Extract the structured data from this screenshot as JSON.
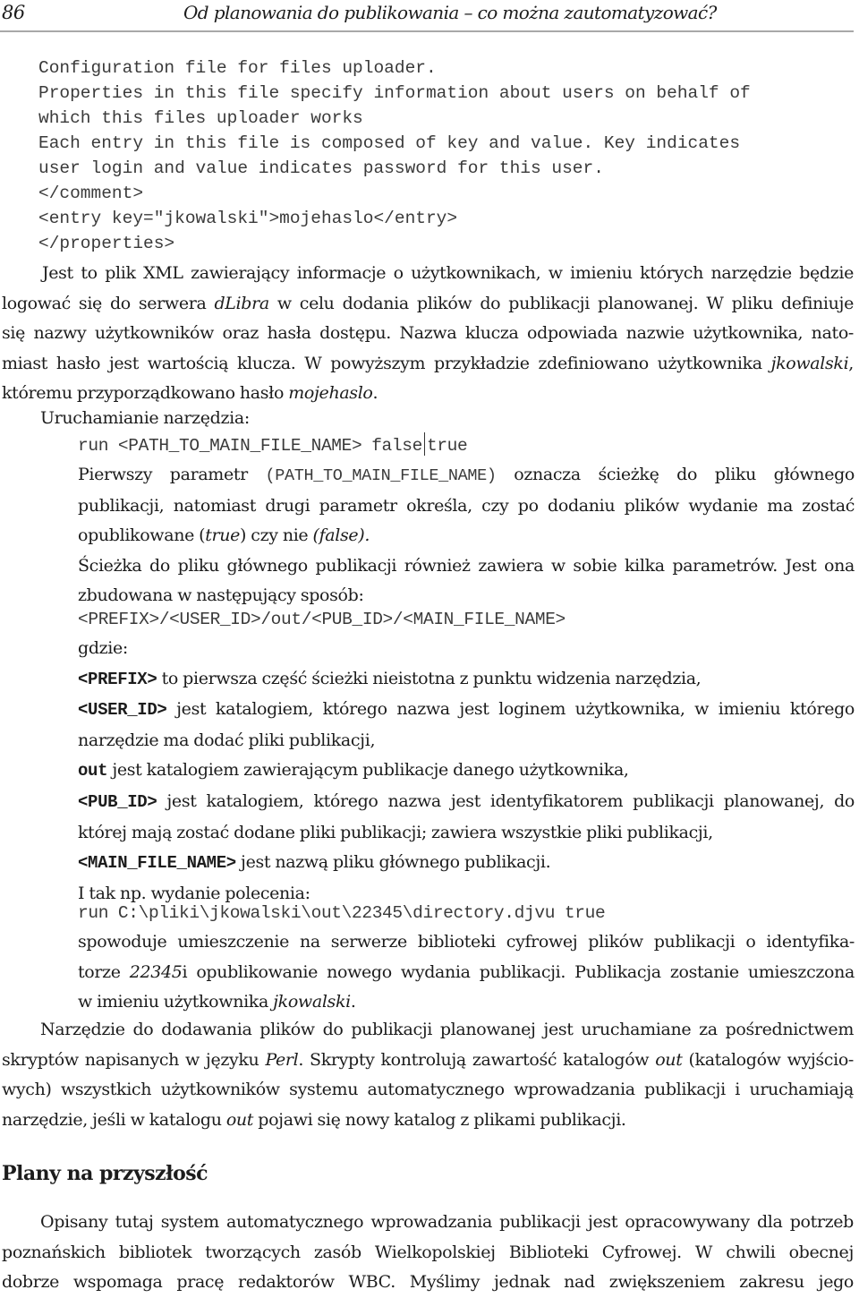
{
  "header": {
    "page_number": "86",
    "running_title": "Od planowania do publikowania – co można zautomatyzować?"
  },
  "xml_listing": [
    "Configuration file for files uploader.",
    "Properties in this file specify information about users on behalf of",
    "which this files uploader works",
    "Each entry in this file is composed of key and value. Key indicates",
    "user login and value indicates password for this user.",
    "</comment>",
    "<entry key=\"jkowalski\">mojehaslo</entry>",
    "</properties>"
  ],
  "para1": {
    "l1": "Jest to plik XML zawierający informacje o użytkownikach, w imieniu których narzędzie będzie",
    "l2a": "logować się do serwera ",
    "l2i": "dLibra",
    "l2b": " w celu dodania plików do publikacji planowanej. W pliku definiuje",
    "l3": "się nazwy użytkowników oraz hasła dostępu. Nazwa klucza odpowiada nazwie użytkownika, nato-",
    "l4a": "miast hasło jest wartością klucza. W powyższym przykładzie zdefiniowano użytkownika ",
    "l4i": "jkowalski",
    "l4b": ",",
    "l5a": "któremu przyporządkowano hasło ",
    "l5i": "mojehaslo",
    "l5b": "."
  },
  "run_section": {
    "label": "Uruchamianie narzędzia:",
    "command_a": "run <PATH_TO_MAIN_FILE_NAME> false",
    "command_b": "true",
    "p1_l1a": "Pierwszy parametr ",
    "p1_l1code": "(PATH_TO_MAIN_FILE_NAME)",
    "p1_l1b": " oznacza ścieżkę do pliku głównego",
    "p1_l2": "publikacji, natomiast drugi parametr określa, czy po dodaniu plików wydanie ma zostać",
    "p1_l3a": "opublikowane (",
    "p1_l3i": "true",
    "p1_l3b": ") czy nie ",
    "p1_l3i2": "(false).",
    "p2_l1": "Ścieżka do pliku głównego publikacji również zawiera w sobie kilka parametrów. Jest ona",
    "p2_l2": "zbudowana w następujący sposób:",
    "path_template": "<PREFIX>/<USER_ID>/out/<PUB_ID>/<MAIN_FILE_NAME>",
    "where": "gdzie:",
    "defs": [
      {
        "term": "<PREFIX>",
        "l1": " to pierwsza część ścieżki nieistotna z punktu widzenia narzędzia,",
        "l2": ""
      },
      {
        "term": "<USER_ID>",
        "l1": " jest katalogiem, którego nazwa jest loginem użytkownika, w imieniu którego",
        "l2": "narzędzie ma dodać pliki publikacji,"
      },
      {
        "term": "out",
        "l1": " jest katalogiem zawierającym publikacje danego użytkownika,",
        "l2": ""
      },
      {
        "term": "<PUB_ID>",
        "l1": " jest katalogiem, którego nazwa jest identyfikatorem publikacji planowanej, do",
        "l2": "której mają zostać dodane pliki publikacji; zawiera wszystkie pliki publikacji,"
      },
      {
        "term": "<MAIN_FILE_NAME>",
        "l1": " jest nazwą pliku głównego publikacji.",
        "l2": ""
      }
    ],
    "example_intro": "I tak np. wydanie polecenia:",
    "example_command": "run C:\\pliki\\jkowalski\\out\\22345\\directory.djvu true",
    "ex_l1": "spowoduje umieszczenie na serwerze biblioteki cyfrowej plików publikacji o identyfika-",
    "ex_l2a": "torze ",
    "ex_l2i": "22345",
    "ex_l2b": "i opublikowanie nowego wydania publikacji. Publikacja zostanie umieszczona",
    "ex_l3a": "w imieniu użytkownika ",
    "ex_l3i": "jkowalski",
    "ex_l3b": "."
  },
  "para2": {
    "l1": "Narzędzie do dodawania plików do publikacji planowanej jest uruchamiane za pośrednictwem",
    "l2a": "skryptów napisanych w języku ",
    "l2i": "Perl",
    "l2b": ". Skrypty kontrolują zawartość katalogów ",
    "l2i2": "out",
    "l2c": " (katalogów wyjścio-",
    "l3": "wych) wszystkich użytkowników systemu automatycznego wprowadzania publikacji i uruchamiają",
    "l4a": "narzędzie, jeśli w katalogu ",
    "l4i": "out",
    "l4b": " pojawi się nowy katalog z plikami publikacji."
  },
  "section": {
    "heading": "Plany na przyszłość",
    "l1": "Opisany tutaj system automatycznego wprowadzania publikacji jest opracowywany dla potrzeb",
    "l2": "poznańskich bibliotek tworzących zasób Wielkopolskiej Biblioteki Cyfrowej. W chwili obecnej",
    "l3": "dobrze wspomaga pracę redaktorów WBC. Myślimy jednak nad zwiększeniem zakresu jego"
  }
}
